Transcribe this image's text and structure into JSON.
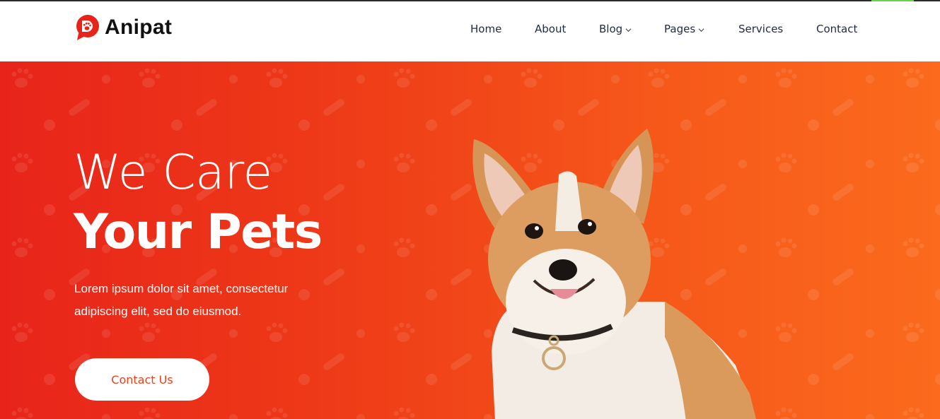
{
  "brand": {
    "name": "Anipat",
    "logo_icon": "paw-chat-bubble-icon",
    "logo_color": "#e8241a"
  },
  "nav": {
    "items": [
      {
        "label": "Home",
        "has_dropdown": false
      },
      {
        "label": "About",
        "has_dropdown": false
      },
      {
        "label": "Blog",
        "has_dropdown": true
      },
      {
        "label": "Pages",
        "has_dropdown": true
      },
      {
        "label": "Services",
        "has_dropdown": false
      },
      {
        "label": "Contact",
        "has_dropdown": false
      }
    ],
    "text_color": "#1f2a44"
  },
  "hero": {
    "title_light": "We Care",
    "title_bold": "Your Pets",
    "text_line1": "Lorem ipsum dolor sit amet, consectetur",
    "text_line2": "adipiscing elit, sed do eiusmod.",
    "button_label": "Contact Us",
    "gradient_start": "#e8241a",
    "gradient_end": "#fb6a1d",
    "image_icon": "corgi-dog-image"
  }
}
